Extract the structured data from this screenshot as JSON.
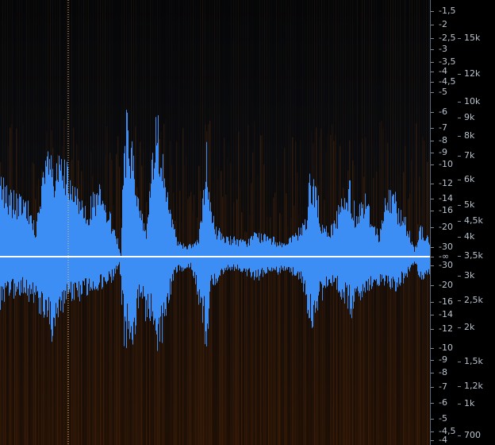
{
  "colors": {
    "waveform": "#3d8ef4",
    "center_line": "#ffffff",
    "playhead": "#e8c77a",
    "spectrogram_warm": "#b85a10",
    "background": "#000000"
  },
  "db_scale": {
    "labels": [
      "-1,5",
      "-2",
      "-2,5",
      "-3",
      "-3,5",
      "-4",
      "-4,5",
      "-5",
      "-6",
      "-7",
      "-8",
      "-9",
      "-10",
      "-12",
      "-14",
      "-16",
      "-20",
      "-30",
      "-∞",
      "-30",
      "-20",
      "-16",
      "-14",
      "-12",
      "-10",
      "-9",
      "-8",
      "-7",
      "-6",
      "-5",
      "-4,5",
      "-4"
    ]
  },
  "hz_scale": {
    "labels": [
      "15k",
      "12k",
      "10k",
      "9k",
      "8k",
      "7k",
      "6k",
      "5k",
      "4,5k",
      "4k",
      "3,5k",
      "3k",
      "2,5k",
      "2k",
      "1,5k",
      "1,2k",
      "1k",
      "700"
    ]
  }
}
